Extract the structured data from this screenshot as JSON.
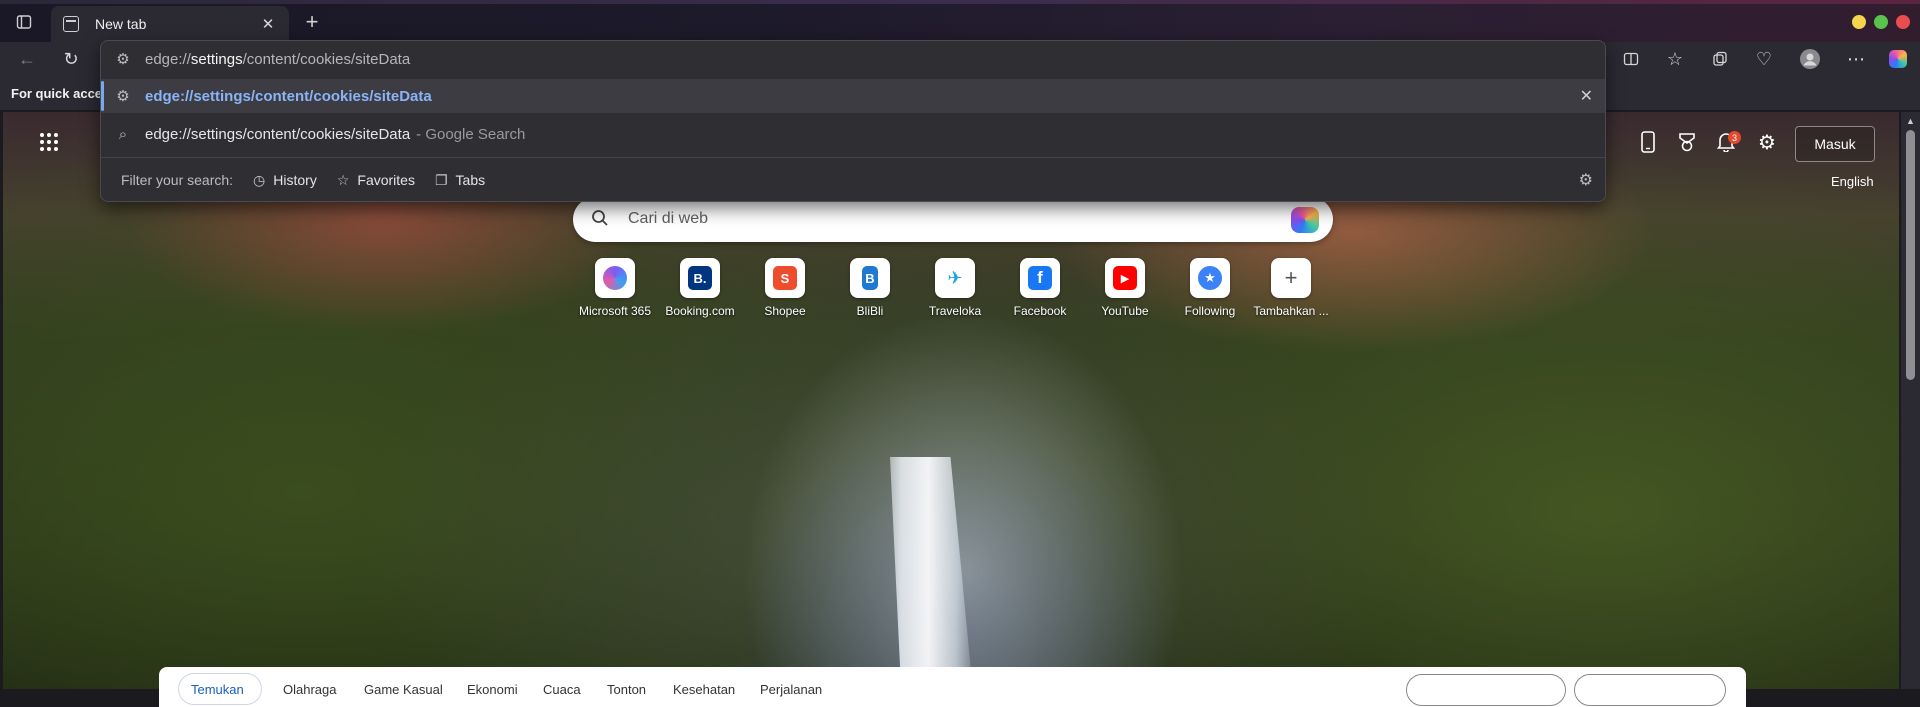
{
  "tab": {
    "title": "New tab"
  },
  "bookmarks_hint": "For quick acces",
  "omnibox": {
    "input_prefix": "edge://",
    "input_host": "settings",
    "input_rest": "/content/cookies/siteData",
    "selected_suggestion": "edge://settings/content/cookies/siteData",
    "search_query": "edge://settings/content/cookies/siteData",
    "search_suffix": "- Google Search",
    "filter_label": "Filter your search:",
    "filters": [
      "History",
      "Favorites",
      "Tabs"
    ]
  },
  "page": {
    "signin_label": "Masuk",
    "language": "English",
    "notification_count": "3",
    "search_placeholder": "Cari di web",
    "shortcuts": [
      {
        "label": "Microsoft 365",
        "color": "#5a4fcf",
        "glyph": ""
      },
      {
        "label": "Booking.com",
        "color": "#003580",
        "glyph": "B."
      },
      {
        "label": "Shopee",
        "color": "#ee4d2d",
        "glyph": "S"
      },
      {
        "label": "BliBli",
        "color": "#1f78d1",
        "glyph": "B"
      },
      {
        "label": "Traveloka",
        "color": "#1ba0e2",
        "glyph": ""
      },
      {
        "label": "Facebook",
        "color": "#1877f2",
        "glyph": "f"
      },
      {
        "label": "YouTube",
        "color": "#ff0000",
        "glyph": "▶"
      },
      {
        "label": "Following",
        "color": "#3b82f6",
        "glyph": "★"
      },
      {
        "label": "Tambahkan ...",
        "color": "#ffffff",
        "glyph": "+"
      }
    ],
    "feed_tabs": [
      "Temukan",
      "Olahraga",
      "Game Kasual",
      "Ekonomi",
      "Cuaca",
      "Tonton",
      "Kesehatan",
      "Perjalanan"
    ]
  }
}
